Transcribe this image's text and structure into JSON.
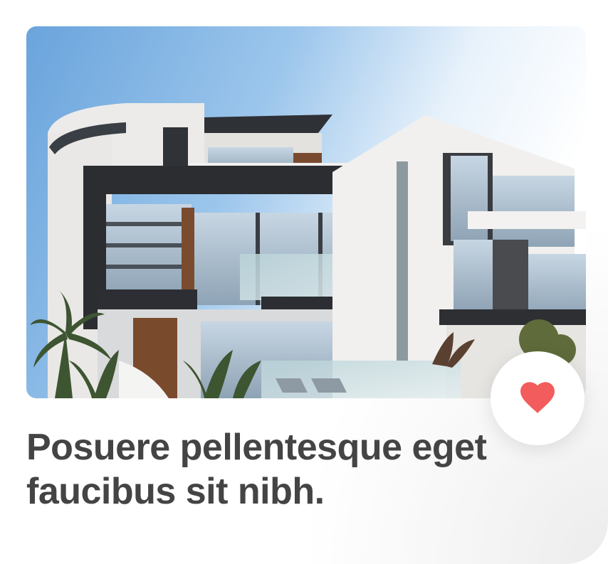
{
  "card": {
    "title": "Posuere pellentesque eget faucibus sit nibh.",
    "image_subject": "modern-white-house-photo",
    "favorite_icon": "heart-icon",
    "colors": {
      "title_text": "#444444",
      "heart": "#f25c5c",
      "background": "#ffffff"
    }
  }
}
